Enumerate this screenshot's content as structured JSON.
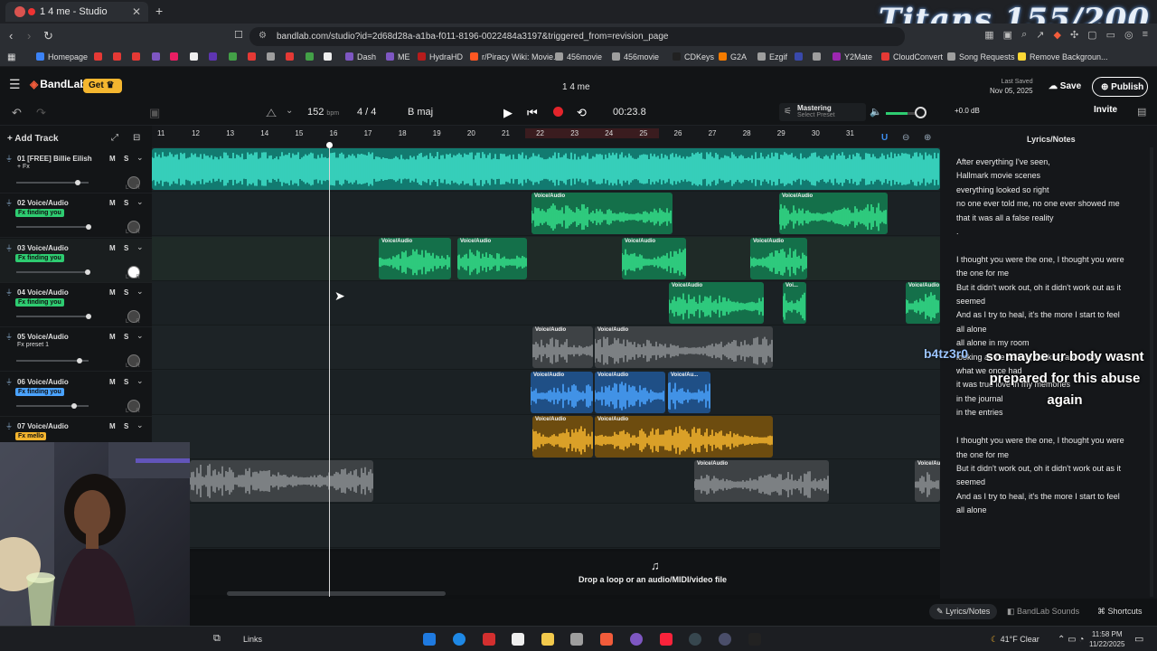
{
  "browser": {
    "tab_title": "1 4 me - Studio",
    "url": "bandlab.com/studio?id=2d68d28a-a1ba-f011-8196-0022484a3197&triggered_from=revision_page",
    "bookmarks": [
      {
        "label": "Homepage",
        "color": "#3b82f6"
      },
      {
        "label": "",
        "color": "#e53935"
      },
      {
        "label": "",
        "color": "#e53935"
      },
      {
        "label": "",
        "color": "#e53935"
      },
      {
        "label": "",
        "color": "#7e57c2"
      },
      {
        "label": "",
        "color": "#e91e63"
      },
      {
        "label": "",
        "color": "#eeeeee"
      },
      {
        "label": "",
        "color": "#5e35b1"
      },
      {
        "label": "",
        "color": "#43a047"
      },
      {
        "label": "",
        "color": "#e53935"
      },
      {
        "label": "",
        "color": "#9e9e9e"
      },
      {
        "label": "",
        "color": "#e53935"
      },
      {
        "label": "",
        "color": "#43a047"
      },
      {
        "label": "",
        "color": "#eeeeee"
      },
      {
        "label": "Dash",
        "color": "#7e57c2"
      },
      {
        "label": "ME",
        "color": "#7e57c2"
      },
      {
        "label": "HydraHD",
        "color": "#b71c1c"
      },
      {
        "label": "r/Piracy Wiki: Movie...",
        "color": "#ff5722"
      },
      {
        "label": "456movie",
        "color": "#9e9e9e"
      },
      {
        "label": "456movie",
        "color": "#9e9e9e"
      },
      {
        "label": "CDKeys",
        "color": "#212121"
      },
      {
        "label": "G2A",
        "color": "#f57c00"
      },
      {
        "label": "Ezgif",
        "color": "#9e9e9e"
      },
      {
        "label": "",
        "color": "#3949ab"
      },
      {
        "label": "",
        "color": "#9e9e9e"
      },
      {
        "label": "Y2Mate",
        "color": "#9c27b0"
      },
      {
        "label": "CloudConvert",
        "color": "#e53935"
      },
      {
        "label": "Song Requests",
        "color": "#9e9e9e"
      },
      {
        "label": "Remove Backgroun...",
        "color": "#fdd835"
      }
    ]
  },
  "overlay_title": "Titans 155/200",
  "header": {
    "brand": "BandLab",
    "get_label": "Get",
    "project_name": "1 4 me",
    "last_saved_label": "Last Saved",
    "last_saved_date": "Nov 05, 2025",
    "save_label": "Save",
    "publish_label": "Publish"
  },
  "toolbar": {
    "tempo": "152",
    "tempo_unit": "bpm",
    "time_signature": "4 / 4",
    "key": "B maj",
    "time": "00:23.8",
    "mastering_label": "Mastering",
    "mastering_preset": "Select Preset",
    "master_volume": "+0.0 dB",
    "invite_label": "Invite"
  },
  "tracks_panel": {
    "add_track_label": "Add Track",
    "tracks": [
      {
        "number": "01",
        "name": "[FREE] Billie Eilish P...",
        "fx": "+ Fx",
        "fx_style": "plain",
        "fx_color": "",
        "fader": 0.95
      },
      {
        "number": "02",
        "name": "Voice/Audio",
        "fx": "Fx finding you",
        "fx_style": "tag",
        "fx_color": "#2ecc71",
        "fader": 1.12
      },
      {
        "number": "03",
        "name": "Voice/Audio",
        "fx": "Fx finding you",
        "fx_style": "tag",
        "fx_color": "#2ecc71",
        "fader": 1.1
      },
      {
        "number": "04",
        "name": "Voice/Audio",
        "fx": "Fx finding you",
        "fx_style": "tag",
        "fx_color": "#2ecc71",
        "fader": 1.12
      },
      {
        "number": "05",
        "name": "Voice/Audio",
        "fx": "Fx preset 1",
        "fx_style": "plain",
        "fx_color": "",
        "fader": 0.98
      },
      {
        "number": "06",
        "name": "Voice/Audio",
        "fx": "Fx finding you",
        "fx_style": "tag",
        "fx_color": "#4aa3ff",
        "fader": 0.9
      },
      {
        "number": "07",
        "name": "Voice/Audio",
        "fx": "Fx mello",
        "fx_style": "tag",
        "fx_color": "#f5b52e",
        "fader": 0.9
      }
    ]
  },
  "ruler": {
    "bars": [
      "11",
      "12",
      "13",
      "14",
      "15",
      "16",
      "17",
      "18",
      "19",
      "20",
      "21",
      "22",
      "23",
      "24",
      "25",
      "26",
      "27",
      "28",
      "29",
      "30",
      "31"
    ]
  },
  "clips": {
    "label": "Voice/Audio",
    "short_label_1": "Voi...",
    "short_label_2": "Voice/Au..."
  },
  "drop_zone": {
    "text": "Drop a loop or an audio/MIDI/video file"
  },
  "lyrics": {
    "title": "Lyrics/Notes",
    "lines": [
      "After everything I've seen,",
      "Hallmark movie scenes",
      "everything looked so right",
      "no one ever told me, no one ever showed me",
      "that it was all a false reality",
      ".",
      "",
      "I thought you were the one, I thought you were the one for me",
      "But it didn't work out, oh it didn't work out as it seemed",
      "And as I try to heal, it's the more I start to feel all alone",
      "all alone in my room",
      "looking at the ceiling, thinking about you",
      "what we once had",
      "it was true love in my memories",
      "in the journal",
      "in the entries",
      "",
      "I thought you were the one, I thought you were the one for me",
      "But it didn't work out, oh it didn't work out as it seemed",
      "And as I try to heal, it's the more I start to feel all alone"
    ]
  },
  "stream_chat": {
    "user": "b4tz3r0",
    "message": "so maybe ur body wasnt prepared for this abuse again"
  },
  "bottom_bar": {
    "lyrics_btn": "Lyrics/Notes",
    "sounds_btn": "BandLab Sounds",
    "shortcuts_btn": "Shortcuts"
  },
  "taskbar": {
    "links_label": "Links",
    "weather": "41°F  Clear",
    "time": "11:58 PM",
    "date": "11/22/2025"
  },
  "colors": {
    "teal": "#1fb8a3",
    "green": "#2ecc71",
    "blue": "#3d8ef0",
    "amber": "#f0ad1f",
    "gray": "#6b6f73",
    "accent_red": "#e3242b"
  }
}
